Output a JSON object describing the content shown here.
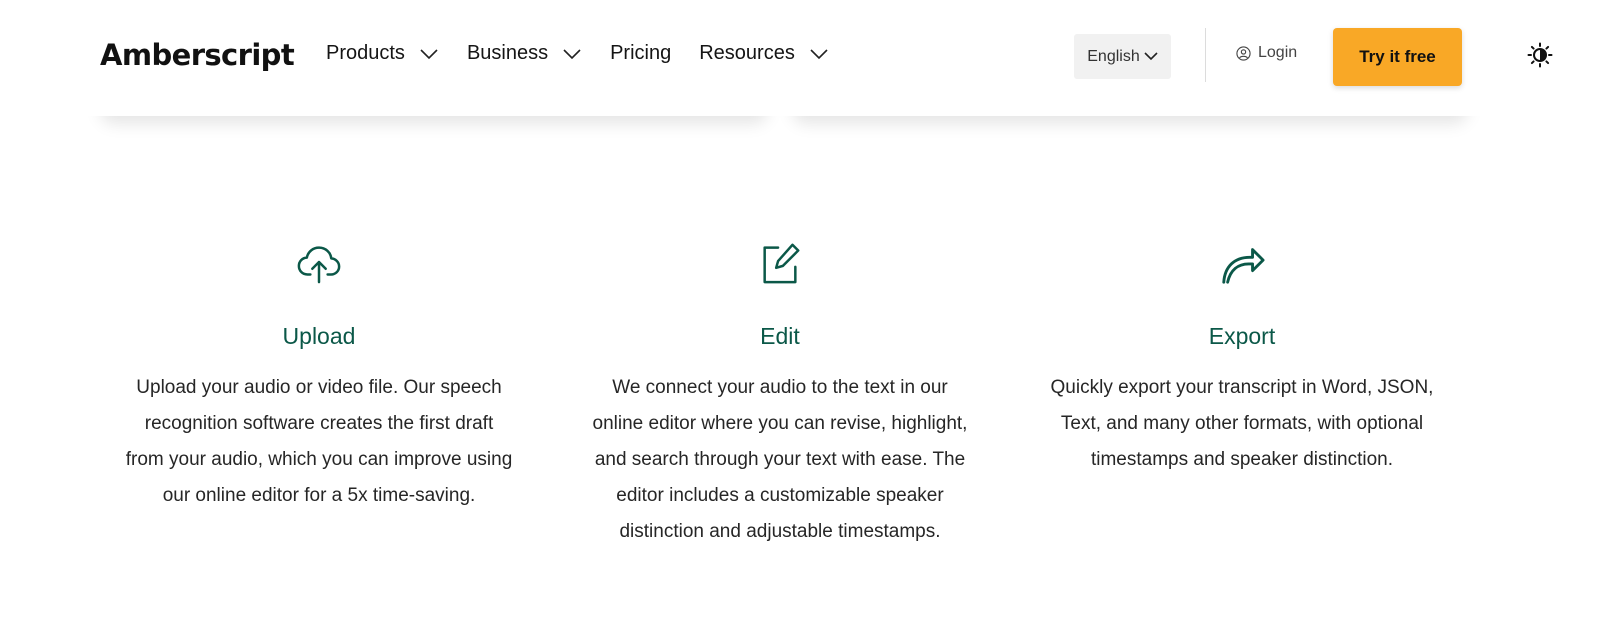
{
  "header": {
    "logo": "Amberscript",
    "nav": [
      {
        "label": "Products",
        "has_dropdown": true
      },
      {
        "label": "Business",
        "has_dropdown": true
      },
      {
        "label": "Pricing",
        "has_dropdown": false
      },
      {
        "label": "Resources",
        "has_dropdown": true
      }
    ],
    "language": "English",
    "login": "Login",
    "cta": "Try it free",
    "cta_color": "#f9a826",
    "theme_icon": "contrast-toggle-icon"
  },
  "features": [
    {
      "icon": "cloud-upload-icon",
      "title": "Upload",
      "text": "Upload your audio or video file. Our speech recognition software creates the first draft from your audio, which you can improve using our online editor for a 5x time-saving."
    },
    {
      "icon": "edit-icon",
      "title": "Edit",
      "text": "We connect your audio to the text in our online editor where you can revise, highlight, and search through your text with ease. The editor includes a customizable speaker distinction and adjustable timestamps."
    },
    {
      "icon": "share-arrow-icon",
      "title": "Export",
      "text": "Quickly export your transcript in Word, JSON, Text, and many other formats, with optional timestamps and speaker distinction."
    }
  ],
  "colors": {
    "accent": "#0b5848",
    "cta": "#f9a826"
  }
}
